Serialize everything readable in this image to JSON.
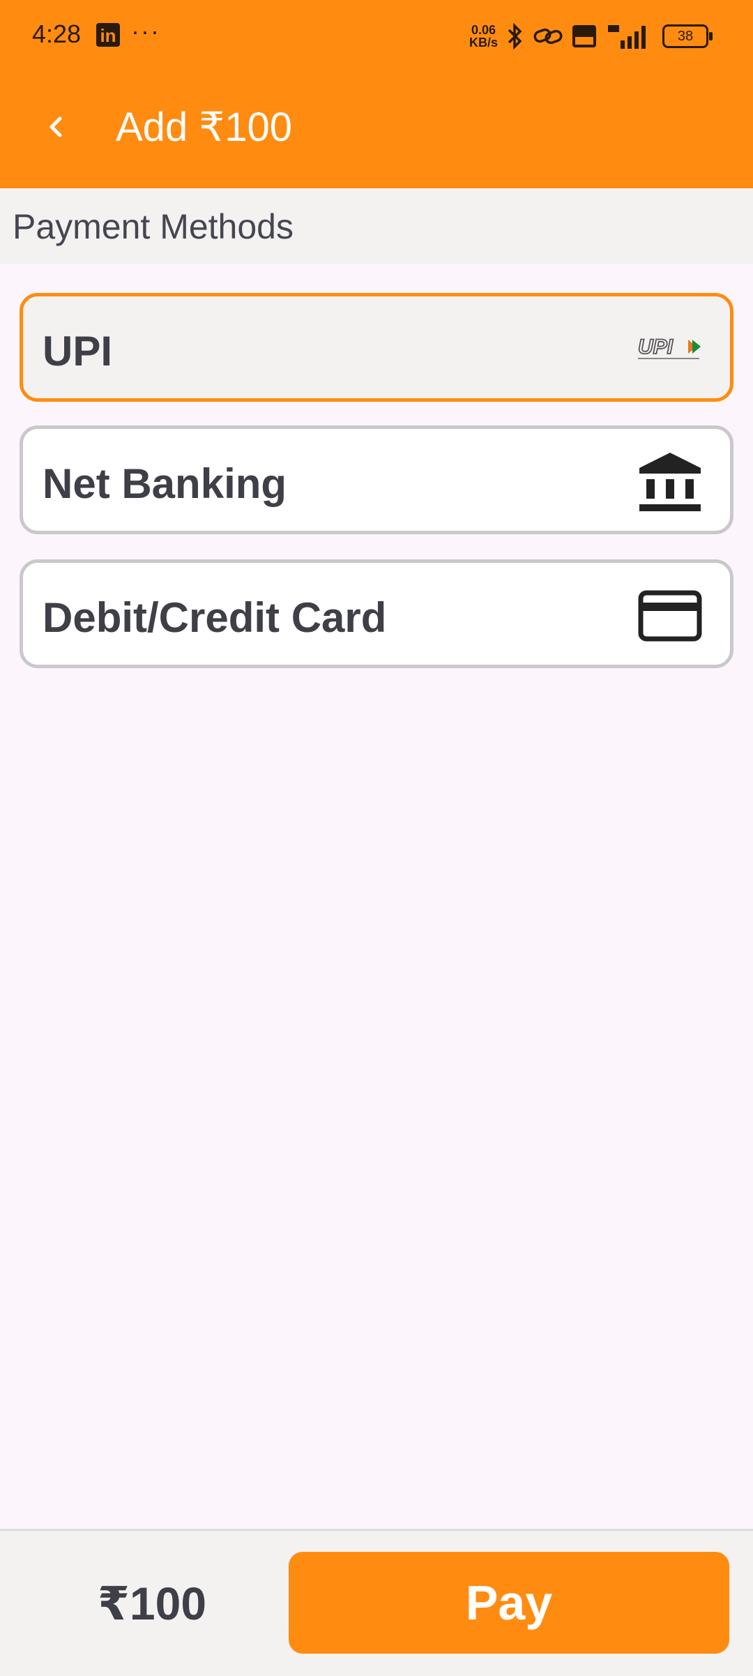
{
  "status_bar": {
    "time": "4:28",
    "linkedin_label": "in",
    "more_dots": "···",
    "net_speed_value": "0.06",
    "net_speed_unit": "KB/s",
    "battery_level": "38"
  },
  "app_bar": {
    "title": "Add ₹100"
  },
  "section": {
    "title": "Payment Methods"
  },
  "payment_methods": [
    {
      "label": "UPI",
      "icon": "upi-logo",
      "selected": true
    },
    {
      "label": "Net Banking",
      "icon": "bank-icon",
      "selected": false
    },
    {
      "label": "Debit/Credit Card",
      "icon": "credit-card-icon",
      "selected": false
    }
  ],
  "footer": {
    "amount": "₹100",
    "pay_label": "Pay"
  },
  "colors": {
    "accent": "#ff8c11",
    "text_dark": "#3f3f48",
    "border": "#c9c9cc",
    "background": "#fcf6fc"
  }
}
